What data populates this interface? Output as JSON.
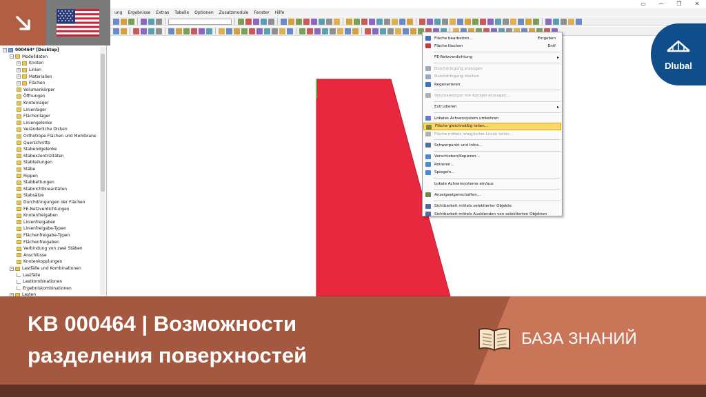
{
  "menubar": {
    "items": [
      "ung",
      "Ergebnisse",
      "Extras",
      "Tabelle",
      "Optionen",
      "Zusatzmodule",
      "Fenster",
      "Hilfe"
    ]
  },
  "tree": {
    "items": [
      {
        "label": "000464* [Desktop]",
        "level": 0,
        "kind": "root"
      },
      {
        "label": "Modelldaten",
        "level": 1,
        "kind": "folder-open"
      },
      {
        "label": "Knoten",
        "level": 2,
        "kind": "folder"
      },
      {
        "label": "Linien",
        "level": 2,
        "kind": "folder"
      },
      {
        "label": "Materialien",
        "level": 2,
        "kind": "folder"
      },
      {
        "label": "Flächen",
        "level": 2,
        "kind": "folder"
      },
      {
        "label": "Volumenkörper",
        "level": 2,
        "kind": "leaf"
      },
      {
        "label": "Öffnungen",
        "level": 2,
        "kind": "leaf"
      },
      {
        "label": "Knotenlager",
        "level": 2,
        "kind": "leaf"
      },
      {
        "label": "Linienlager",
        "level": 2,
        "kind": "leaf"
      },
      {
        "label": "Flächenlager",
        "level": 2,
        "kind": "leaf"
      },
      {
        "label": "Liniengelenke",
        "level": 2,
        "kind": "leaf"
      },
      {
        "label": "Veränderliche Dicken",
        "level": 2,
        "kind": "leaf"
      },
      {
        "label": "Orthotrope Flächen und Membrane",
        "level": 2,
        "kind": "leaf"
      },
      {
        "label": "Querschnitte",
        "level": 2,
        "kind": "leaf"
      },
      {
        "label": "Stabendgelenke",
        "level": 2,
        "kind": "leaf"
      },
      {
        "label": "Stabexzentrizitäten",
        "level": 2,
        "kind": "leaf"
      },
      {
        "label": "Stabteilungen",
        "level": 2,
        "kind": "leaf"
      },
      {
        "label": "Stäbe",
        "level": 2,
        "kind": "leaf"
      },
      {
        "label": "Rippen",
        "level": 2,
        "kind": "leaf"
      },
      {
        "label": "Stabbettungen",
        "level": 2,
        "kind": "leaf"
      },
      {
        "label": "Stabnichtlinearitäten",
        "level": 2,
        "kind": "leaf"
      },
      {
        "label": "Stabsätze",
        "level": 2,
        "kind": "leaf"
      },
      {
        "label": "Durchdringungen der Flächen",
        "level": 2,
        "kind": "leaf"
      },
      {
        "label": "FE-Netzverdichtungen",
        "level": 2,
        "kind": "leaf"
      },
      {
        "label": "Knotenfreigaben",
        "level": 2,
        "kind": "leaf"
      },
      {
        "label": "Linienfreigaben",
        "level": 2,
        "kind": "leaf"
      },
      {
        "label": "Linienfreigabe-Typen",
        "level": 2,
        "kind": "leaf"
      },
      {
        "label": "Flächenfreigabe-Typen",
        "level": 2,
        "kind": "leaf"
      },
      {
        "label": "Flächenfreigaben",
        "level": 2,
        "kind": "leaf"
      },
      {
        "label": "Verbindung von zwei Stäben",
        "level": 2,
        "kind": "leaf"
      },
      {
        "label": "Anschlüsse",
        "level": 2,
        "kind": "leaf"
      },
      {
        "label": "Knotenkopplungen",
        "level": 2,
        "kind": "leaf"
      },
      {
        "label": "Lastfälle und Kombinationen",
        "level": 1,
        "kind": "folder-open"
      },
      {
        "label": "Lastfälle",
        "level": 2,
        "kind": "line"
      },
      {
        "label": "Lastkombinationen",
        "level": 2,
        "kind": "line"
      },
      {
        "label": "Ergebniskombinationen",
        "level": 2,
        "kind": "line"
      },
      {
        "label": "Lasten",
        "level": 1,
        "kind": "folder"
      }
    ]
  },
  "context_menu": {
    "items": [
      {
        "label": "Fläche bearbeiten...",
        "shortcut": "Eingeben",
        "state": "normal",
        "icon_color": "#3a6fc4"
      },
      {
        "label": "Fläche löschen",
        "shortcut": "Entf",
        "state": "normal",
        "icon_color": "#c43a3a"
      },
      {
        "separator": true
      },
      {
        "label": "FE-Netzverdichtung",
        "submenu": true,
        "state": "normal"
      },
      {
        "separator": true
      },
      {
        "label": "Durchdringung erzeugen",
        "state": "disabled",
        "icon_color": "#9aa8c0"
      },
      {
        "label": "Durchdringung löschen",
        "state": "disabled",
        "icon_color": "#9aa8c0"
      },
      {
        "label": "Regenerieren",
        "state": "normal",
        "icon_color": "#3a6fc4"
      },
      {
        "separator": true
      },
      {
        "label": "Volumenkörper mit Kontakt erzeugen...",
        "state": "disabled",
        "icon_color": "#b0b0b0"
      },
      {
        "separator": true
      },
      {
        "label": "Extrudieren",
        "submenu": true,
        "state": "normal"
      },
      {
        "separator": true
      },
      {
        "label": "Lokales Achsensystem umkehren",
        "state": "normal",
        "icon_color": "#5a7fd4"
      },
      {
        "label": "Fläche gleichmäßig teilen...",
        "state": "highlighted",
        "icon_color": "#7a8a3a"
      },
      {
        "label": "Fläche mittels integrierter Linien teilen...",
        "state": "disabled",
        "icon_color": "#b0b0b0"
      },
      {
        "separator": true
      },
      {
        "label": "Schwerpunkt und Infos...",
        "state": "normal",
        "icon_color": "#4a6fa0"
      },
      {
        "separator": true
      },
      {
        "label": "Verschieben/Kopieren...",
        "state": "normal",
        "icon_color": "#4a8ad4"
      },
      {
        "label": "Rotieren...",
        "state": "normal",
        "icon_color": "#4a8ad4"
      },
      {
        "label": "Spiegeln...",
        "state": "normal",
        "icon_color": "#4a8ad4"
      },
      {
        "separator": true
      },
      {
        "label": "Lokale Achsensysteme ein/aus",
        "state": "normal",
        "icon_color": null
      },
      {
        "separator": true
      },
      {
        "label": "Anzeigeeigenschaften...",
        "state": "normal",
        "icon_color": "#6a8a4a"
      },
      {
        "separator": true
      },
      {
        "label": "Sichtbarkeit mittels selektierter Objekte",
        "state": "normal",
        "icon_color": "#4a6fa0"
      },
      {
        "label": "Sichtbarkeit mittels Ausblenden von selektierten Objekten",
        "state": "normal",
        "icon_color": "#4a6fa0"
      }
    ]
  },
  "logo": {
    "text": "Dlubal"
  },
  "banner": {
    "title_line1": "KB 000464 | Возможности",
    "title_line2": "разделения поверхностей",
    "category": "БАЗА ЗНАНИЙ"
  },
  "colors": {
    "surface": "#e8283f",
    "banner": "#a4583f",
    "banner_accent": "#c97558",
    "logo": "#104e8b",
    "highlight": "#ffd86a"
  },
  "window_controls": [
    "▭",
    "—",
    "❐",
    "✕"
  ]
}
